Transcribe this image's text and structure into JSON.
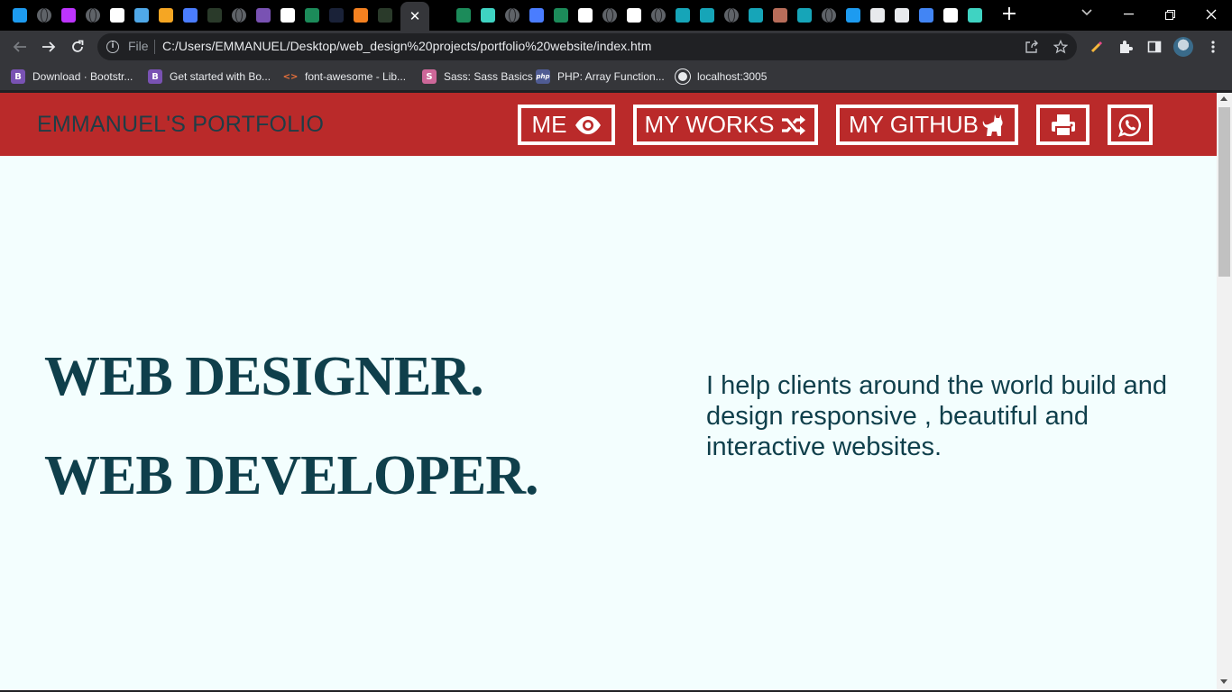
{
  "browser": {
    "tabs": [
      {
        "icon": "twitter-icon",
        "color": "#1d9bf0"
      },
      {
        "icon": "globe-icon",
        "color": "#5f6368"
      },
      {
        "icon": "vite-icon",
        "color": "#bd34fe"
      },
      {
        "icon": "globe-icon",
        "color": "#5f6368"
      },
      {
        "icon": "github-icon",
        "color": "#ffffff"
      },
      {
        "icon": "upload-icon",
        "color": "#4fa8e8"
      },
      {
        "icon": "app-icon",
        "color": "#f5a623"
      },
      {
        "icon": "flag-icon",
        "color": "#4a7dff"
      },
      {
        "icon": "dark-app-icon",
        "color": "#2a3a2a"
      },
      {
        "icon": "globe-icon",
        "color": "#5f6368"
      },
      {
        "icon": "bootstrap-icon",
        "color": "#7952b3"
      },
      {
        "icon": "github-icon",
        "color": "#ffffff"
      },
      {
        "icon": "webflow-icon",
        "color": "#1c8b5a"
      },
      {
        "icon": "dark-app-icon",
        "color": "#1a2238"
      },
      {
        "icon": "cloudflare-icon",
        "color": "#f48120"
      },
      {
        "icon": "dark-app-icon",
        "color": "#2a3a2a"
      }
    ],
    "active_tab_close": "✕",
    "tabs_after": [
      {
        "icon": "webflow-icon",
        "color": "#1c8b5a"
      },
      {
        "icon": "chakra-icon",
        "color": "#3fd3c2"
      },
      {
        "icon": "globe-icon",
        "color": "#5f6368"
      },
      {
        "icon": "flag-icon",
        "color": "#4a7dff"
      },
      {
        "icon": "webflow-icon",
        "color": "#1c8b5a"
      },
      {
        "icon": "medium-icon",
        "color": "#ffffff"
      },
      {
        "icon": "globe-icon",
        "color": "#5f6368"
      },
      {
        "icon": "puzzle-icon",
        "color": "#ffffff"
      },
      {
        "icon": "globe-icon",
        "color": "#5f6368"
      },
      {
        "icon": "diamond-icon",
        "color": "#16a5b8"
      },
      {
        "icon": "diamond-icon",
        "color": "#16a5b8"
      },
      {
        "icon": "globe-icon",
        "color": "#5f6368"
      },
      {
        "icon": "diamond-icon",
        "color": "#16a5b8"
      },
      {
        "icon": "photo-icon",
        "color": "#b86d5a"
      },
      {
        "icon": "diamond-icon",
        "color": "#16a5b8"
      },
      {
        "icon": "globe-icon",
        "color": "#5f6368"
      },
      {
        "icon": "twitter-icon",
        "color": "#1d9bf0"
      },
      {
        "icon": "doc-icon",
        "color": "#e8eaed"
      },
      {
        "icon": "doc-icon",
        "color": "#e8eaed"
      },
      {
        "icon": "google-icon",
        "color": "#4285f4"
      },
      {
        "icon": "medium-icon",
        "color": "#ffffff"
      },
      {
        "icon": "chakra-icon",
        "color": "#3fd3c2"
      }
    ],
    "new_tab": "+",
    "address": {
      "scheme_label": "File",
      "url": "C:/Users/EMMANUEL/Desktop/web_design%20projects/portfolio%20website/index.htm"
    },
    "bookmarks": [
      {
        "label": "Download · Bootstr...",
        "icon": "bootstrap-icon",
        "color": "#7952b3",
        "glyph": "B"
      },
      {
        "label": "Get started with Bo...",
        "icon": "bootstrap-icon",
        "color": "#7952b3",
        "glyph": "B"
      },
      {
        "label": "font-awesome - Lib...",
        "icon": "code-icon",
        "color": "#e8703a",
        "glyph": "<>"
      },
      {
        "label": "Sass: Sass Basics",
        "icon": "sass-icon",
        "color": "#cd6799",
        "glyph": "S"
      },
      {
        "label": "PHP: Array Function...",
        "icon": "php-icon",
        "color": "#4f5b93",
        "glyph": "php"
      },
      {
        "label": "localhost:3005",
        "icon": "globe-icon",
        "color": "#e8eaed",
        "glyph": ""
      }
    ]
  },
  "page": {
    "brand": "EMMANUEL'S PORTFOLIO",
    "nav": [
      {
        "label": "ME",
        "icon": "eye-icon"
      },
      {
        "label": "MY WORKS",
        "icon": "shuffle-icon"
      },
      {
        "label": "MY GITHUB",
        "icon": "github-cat-icon"
      },
      {
        "label": "",
        "icon": "print-icon"
      },
      {
        "label": "",
        "icon": "whatsapp-icon"
      }
    ],
    "hero": {
      "title_1": "WEB DESIGNER.",
      "title_2": "WEB DEVELOPER.",
      "text": "I help clients around the world build and design responsive , beautiful and interactive websites."
    },
    "colors": {
      "nav_bg": "#ba2a2a",
      "page_bg": "#f3fefe",
      "heading": "#0f3f4b",
      "brand": "#1f3d46"
    },
    "scroll_position": 0
  }
}
